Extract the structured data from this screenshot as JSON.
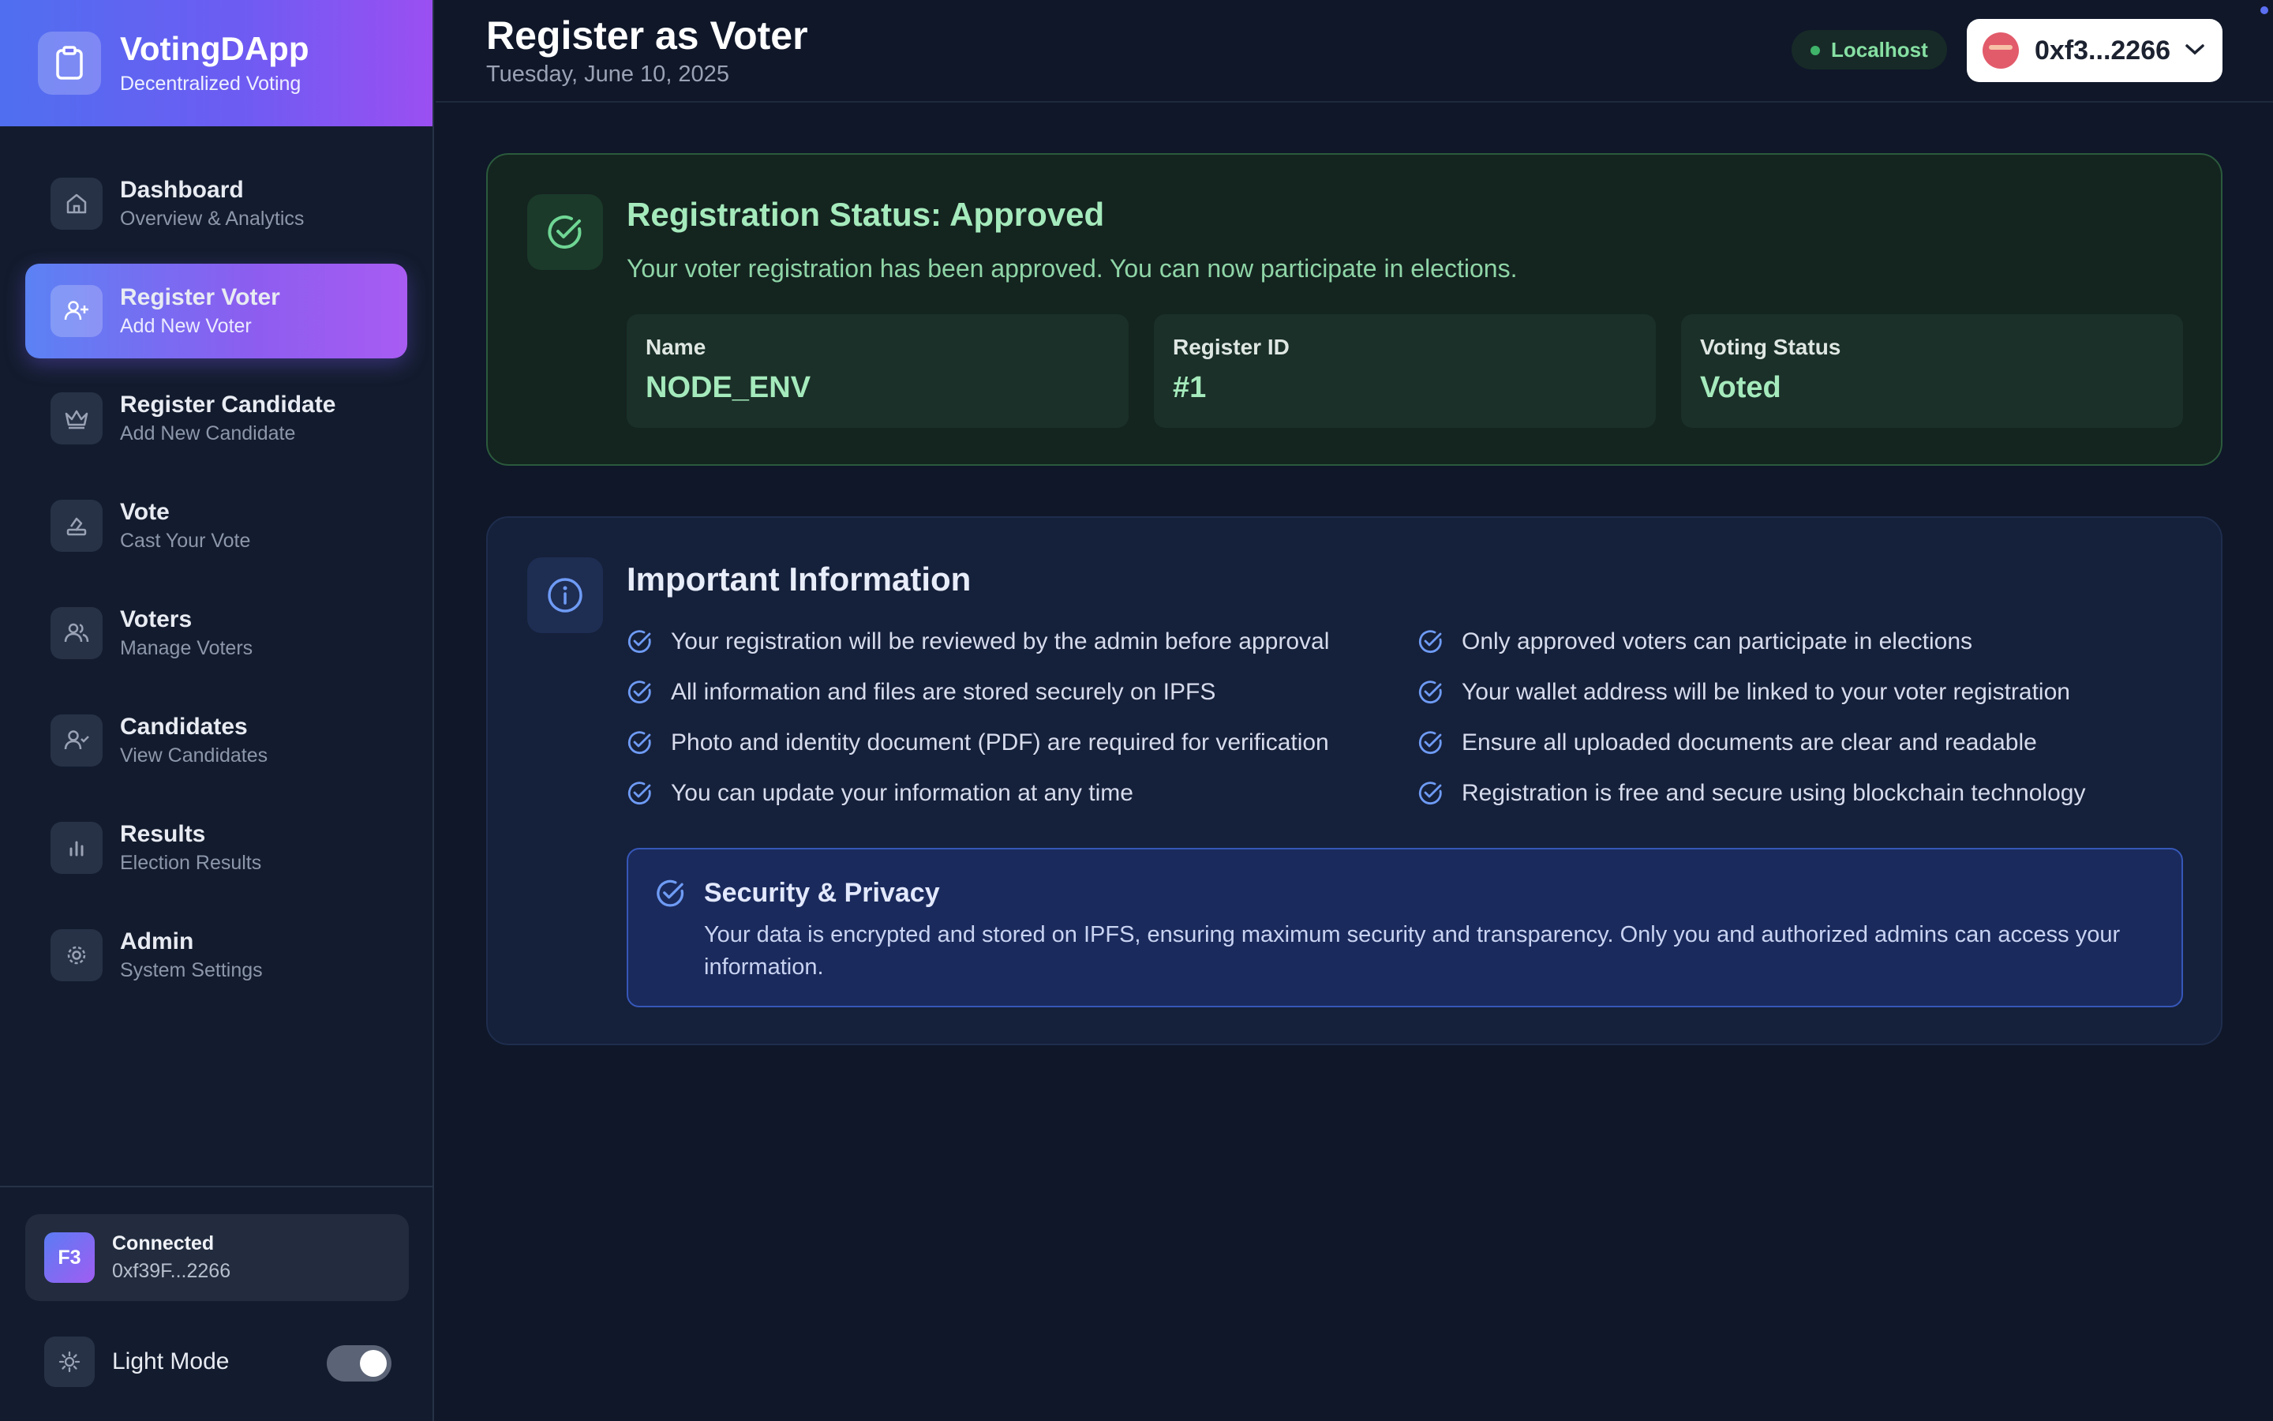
{
  "app": {
    "title": "VotingDApp",
    "subtitle": "Decentralized Voting"
  },
  "nav": {
    "items": [
      {
        "label": "Dashboard",
        "sub": "Overview & Analytics",
        "icon": "home-icon"
      },
      {
        "label": "Register Voter",
        "sub": "Add New Voter",
        "icon": "user-plus-icon",
        "active": true
      },
      {
        "label": "Register Candidate",
        "sub": "Add New Candidate",
        "icon": "crown-icon"
      },
      {
        "label": "Vote",
        "sub": "Cast Your Vote",
        "icon": "ballot-icon"
      },
      {
        "label": "Voters",
        "sub": "Manage Voters",
        "icon": "users-icon"
      },
      {
        "label": "Candidates",
        "sub": "View Candidates",
        "icon": "user-check-icon"
      },
      {
        "label": "Results",
        "sub": "Election Results",
        "icon": "bar-chart-icon"
      },
      {
        "label": "Admin",
        "sub": "System Settings",
        "icon": "gear-icon"
      }
    ]
  },
  "account": {
    "initials": "F3",
    "status": "Connected",
    "address": "0xf39F...2266"
  },
  "theme": {
    "label": "Light Mode"
  },
  "header": {
    "title": "Register as Voter",
    "date": "Tuesday, June 10, 2025",
    "network": "Localhost",
    "wallet": "0xf3...2266"
  },
  "status": {
    "title": "Registration Status: Approved",
    "description": "Your voter registration has been approved. You can now participate in elections.",
    "fields": [
      {
        "label": "Name",
        "value": "NODE_ENV"
      },
      {
        "label": "Register ID",
        "value": "#1"
      },
      {
        "label": "Voting Status",
        "value": "Voted"
      }
    ]
  },
  "info": {
    "title": "Important Information",
    "points_left": [
      "Your registration will be reviewed by the admin before approval",
      "All information and files are stored securely on IPFS",
      "Photo and identity document (PDF) are required for verification",
      "You can update your information at any time"
    ],
    "points_right": [
      "Only approved voters can participate in elections",
      "Your wallet address will be linked to your voter registration",
      "Ensure all uploaded documents are clear and readable",
      "Registration is free and secure using blockchain technology"
    ],
    "security": {
      "title": "Security & Privacy",
      "text": "Your data is encrypted and stored on IPFS, ensuring maximum security and transparency. Only you and authorized admins can access your information."
    }
  },
  "colors": {
    "accent": "#6d5cf2",
    "success": "#a5eabc",
    "info": "#6e9bf5"
  }
}
